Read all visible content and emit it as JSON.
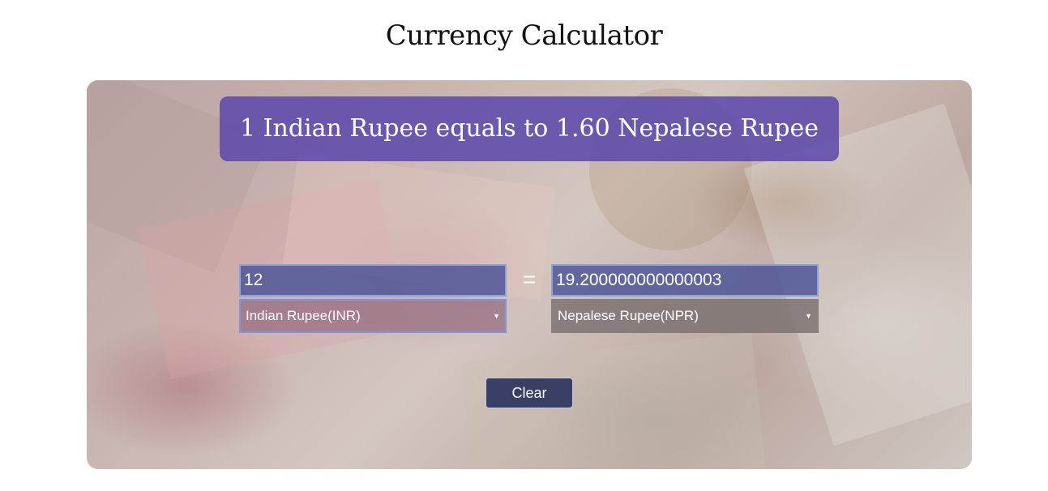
{
  "page": {
    "title": "Currency Calculator"
  },
  "calculator": {
    "rate_text": "1 Indian Rupee equals to 1.60 Nepalese Rupee",
    "from_amount": "12",
    "to_amount": "19.200000000000003",
    "equals_symbol": "=",
    "from_currency": "Indian Rupee(INR)",
    "to_currency": "Nepalese Rupee(NPR)",
    "clear_label": "Clear",
    "dropdown_arrow": "▼"
  },
  "colors": {
    "banner": "#5a46aa",
    "input_bg": "#465096",
    "button_bg": "#3a3f66"
  }
}
